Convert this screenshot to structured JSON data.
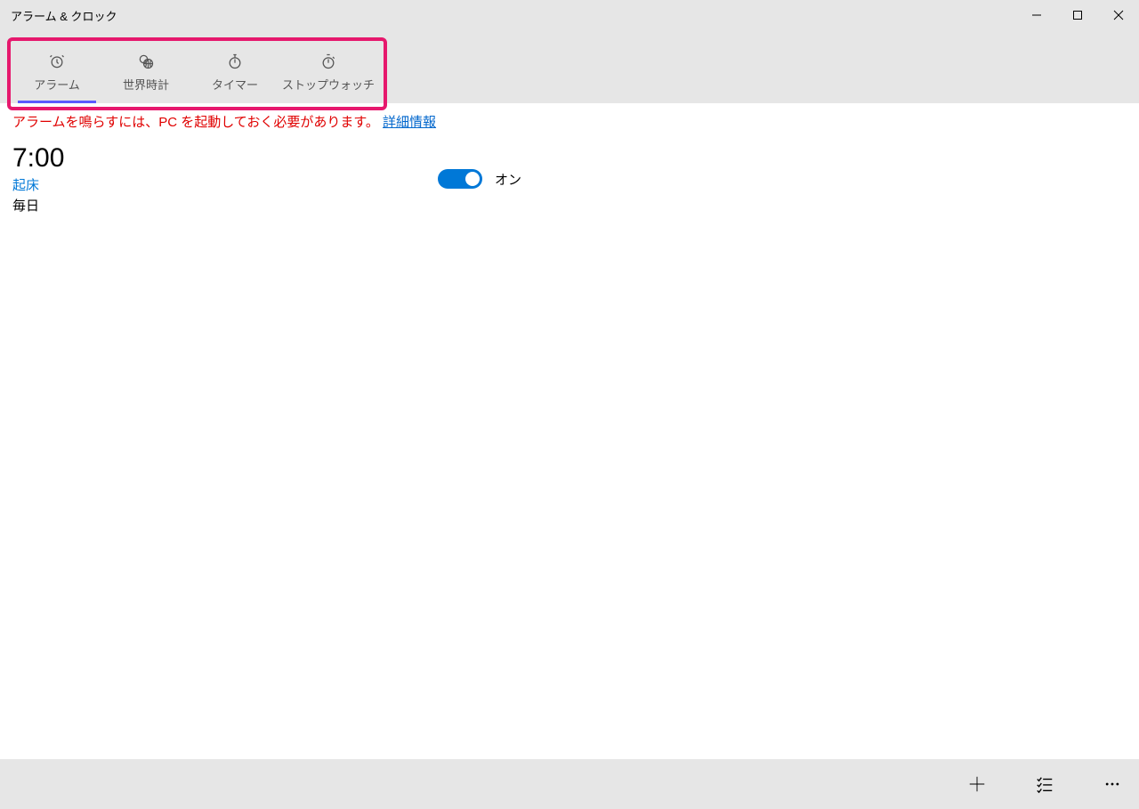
{
  "title": "アラーム & クロック",
  "tabs": {
    "alarm": "アラーム",
    "world": "世界時計",
    "timer": "タイマー",
    "stopwatch": "ストップウォッチ"
  },
  "banner": {
    "notice": "アラームを鳴らすには、PC を起動しておく必要があります。",
    "link": "詳細情報"
  },
  "alarm": {
    "time": "7:00",
    "name": "起床",
    "repeat": "毎日",
    "toggle_label": "オン"
  }
}
